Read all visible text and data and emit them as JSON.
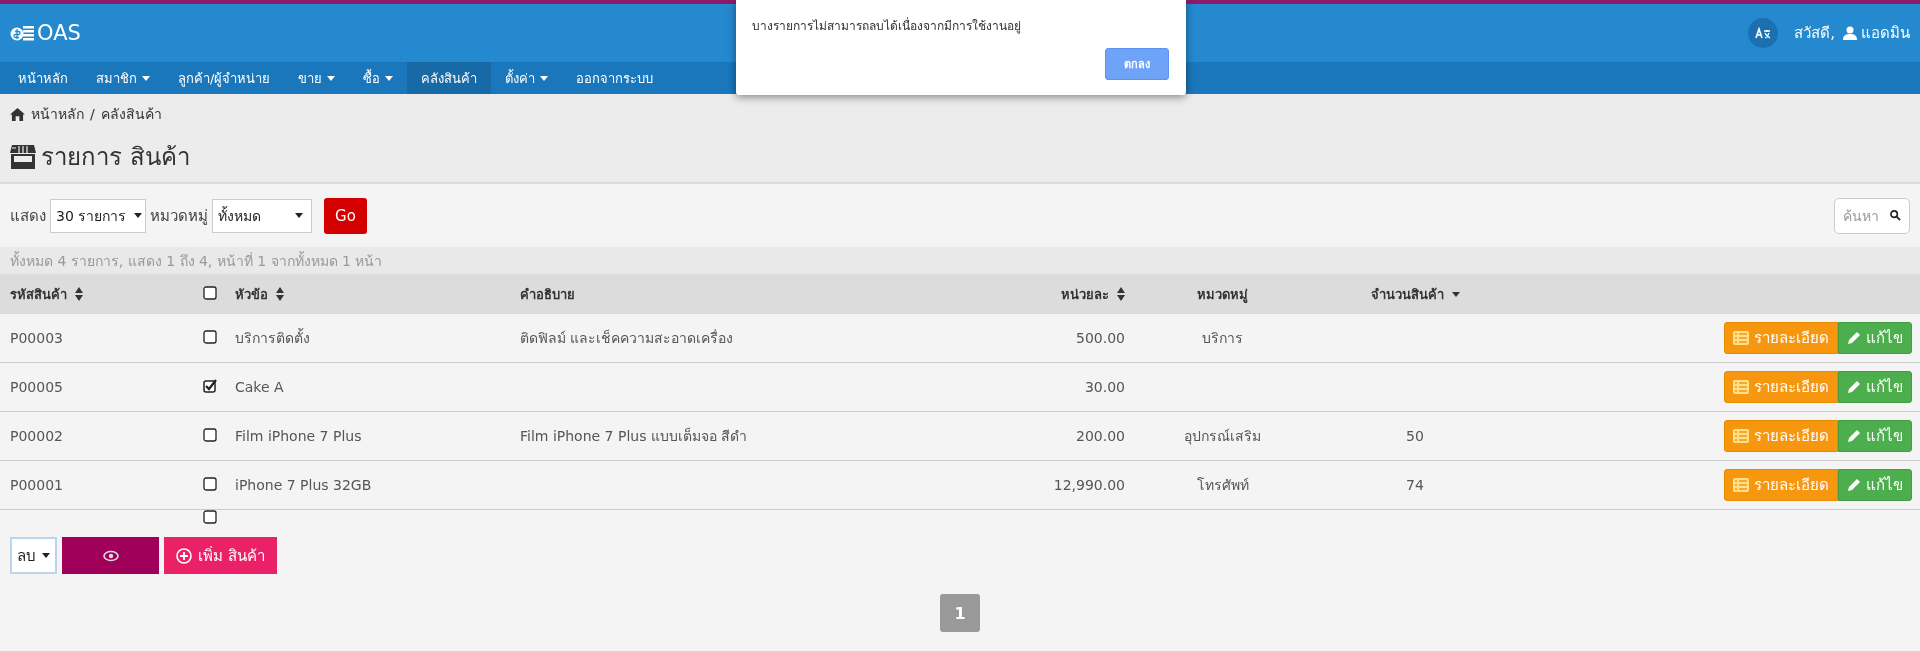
{
  "header": {
    "logo": "OAS",
    "greeting": "สวัสดี,",
    "user": "แอดมิน"
  },
  "nav": [
    {
      "label": "หน้าหลัก",
      "dropdown": false,
      "selected": false
    },
    {
      "label": "สมาชิก",
      "dropdown": true,
      "selected": false
    },
    {
      "label": "ลูกค้า/ผู้จำหน่าย",
      "dropdown": false,
      "selected": false
    },
    {
      "label": "ขาย",
      "dropdown": true,
      "selected": false
    },
    {
      "label": "ซื้อ",
      "dropdown": true,
      "selected": false
    },
    {
      "label": "คลังสินค้า",
      "dropdown": false,
      "selected": true
    },
    {
      "label": "ตั้งค่า",
      "dropdown": true,
      "selected": false
    },
    {
      "label": "ออกจากระบบ",
      "dropdown": false,
      "selected": false
    }
  ],
  "dialog": {
    "message": "บางรายการไม่สามารถลบได้เนื่องจากมีการใช้งานอยู่",
    "button": "ตกลง"
  },
  "breadcrumb": [
    "หน้าหลัก",
    "คลังสินค้า"
  ],
  "breadcrumb_separator": "/",
  "title": "รายการ สินค้า",
  "filters": {
    "show_label": "แสดง",
    "page_size": "30 รายการ",
    "category_label": "หมวดหมู่",
    "category": "ทั้งหมด",
    "go": "Go",
    "search_placeholder": "ค้นหา"
  },
  "summary": "ทั้งหมด 4 รายการ, แสดง 1 ถึง 4, หน้าที่ 1 จากทั้งหมด 1 หน้า",
  "table": {
    "columns": [
      {
        "kind": "text",
        "label": "รหัสสินค้า",
        "sortable": true,
        "sorted_desc": false
      },
      {
        "kind": "checkbox",
        "checked": false
      },
      {
        "kind": "text",
        "label": "หัวข้อ",
        "sortable": true,
        "sorted_desc": false
      },
      {
        "kind": "text",
        "label": "คำอธิบาย",
        "sortable": false,
        "sorted_desc": false
      },
      {
        "kind": "text",
        "label": "หน่วยละ",
        "sortable": true,
        "sorted_desc": false
      },
      {
        "kind": "text",
        "label": "หมวดหมู่",
        "sortable": false,
        "sorted_desc": false
      },
      {
        "kind": "text",
        "label": "จำนวนสินค้า",
        "sortable": false,
        "sorted_desc": true
      }
    ],
    "rows": [
      {
        "code": "P00003",
        "checked": false,
        "title": "บริการติดตั้ง",
        "description": "ติดฟิลม์ และเช็คความสะอาดเครื่อง",
        "price": "500.00",
        "category": "บริการ",
        "quantity": "",
        "detail": "รายละเอียด",
        "edit": "แก้ไข"
      },
      {
        "code": "P00005",
        "checked": true,
        "title": "Cake A",
        "description": "",
        "price": "30.00",
        "category": "",
        "quantity": "",
        "detail": "รายละเอียด",
        "edit": "แก้ไข"
      },
      {
        "code": "P00002",
        "checked": false,
        "title": "Film iPhone 7 Plus",
        "description": "Film iPhone 7 Plus แบบเต็มจอ สีดำ",
        "price": "200.00",
        "category": "อุปกรณ์เสริม",
        "quantity": "50",
        "detail": "รายละเอียด",
        "edit": "แก้ไข"
      },
      {
        "code": "P00001",
        "checked": false,
        "title": "iPhone 7 Plus 32GB",
        "description": "",
        "price": "12,990.00",
        "category": "โทรศัพท์",
        "quantity": "74",
        "detail": "รายละเอียด",
        "edit": "แก้ไข"
      }
    ],
    "footer_checkbox": {
      "checked": false
    }
  },
  "bulk": {
    "action": "ลบ",
    "add": "เพิ่ม สินค้า"
  },
  "pagination": [
    {
      "label": "1",
      "selected": true
    }
  ]
}
